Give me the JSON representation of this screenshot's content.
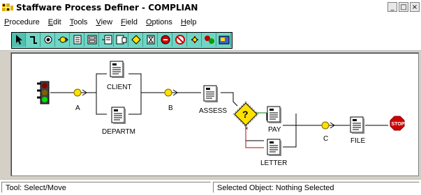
{
  "window": {
    "title": "Staffware Process Definer - COMPLIAN",
    "minimize": "_",
    "maximize": "□",
    "close": "×"
  },
  "menu": [
    "Procedure",
    "Edit",
    "Tools",
    "View",
    "Field",
    "Options",
    "Help"
  ],
  "menu_underline": [
    "P",
    "E",
    "T",
    "V",
    "F",
    "O",
    "H"
  ],
  "toolbar": {
    "tools": [
      {
        "name": "select-move-icon",
        "active": true
      },
      {
        "name": "connection-icon"
      },
      {
        "name": "start-icon"
      },
      {
        "name": "event-icon"
      },
      {
        "name": "step-icon"
      },
      {
        "name": "form-icon"
      },
      {
        "name": "subprocedure-icon"
      },
      {
        "name": "ef-step-icon"
      },
      {
        "name": "condition-icon"
      },
      {
        "name": "wait-icon"
      },
      {
        "name": "stop-icon"
      },
      {
        "name": "withdraw-icon"
      },
      {
        "name": "script-icon"
      },
      {
        "name": "complex-router-icon"
      },
      {
        "name": "graph-icon"
      }
    ]
  },
  "diagram": {
    "nodes": {
      "client": "CLIENT",
      "departm": "DEPARTM",
      "assess": "ASSESS",
      "pay": "PAY",
      "letter": "LETTER",
      "file": "FILE",
      "wait_a": "A",
      "wait_b": "B",
      "wait_c": "C",
      "stop": "STOP",
      "condition": "?"
    }
  },
  "status": {
    "tool": "Tool: Select/Move",
    "selection": "Selected Object: Nothing Selected"
  }
}
